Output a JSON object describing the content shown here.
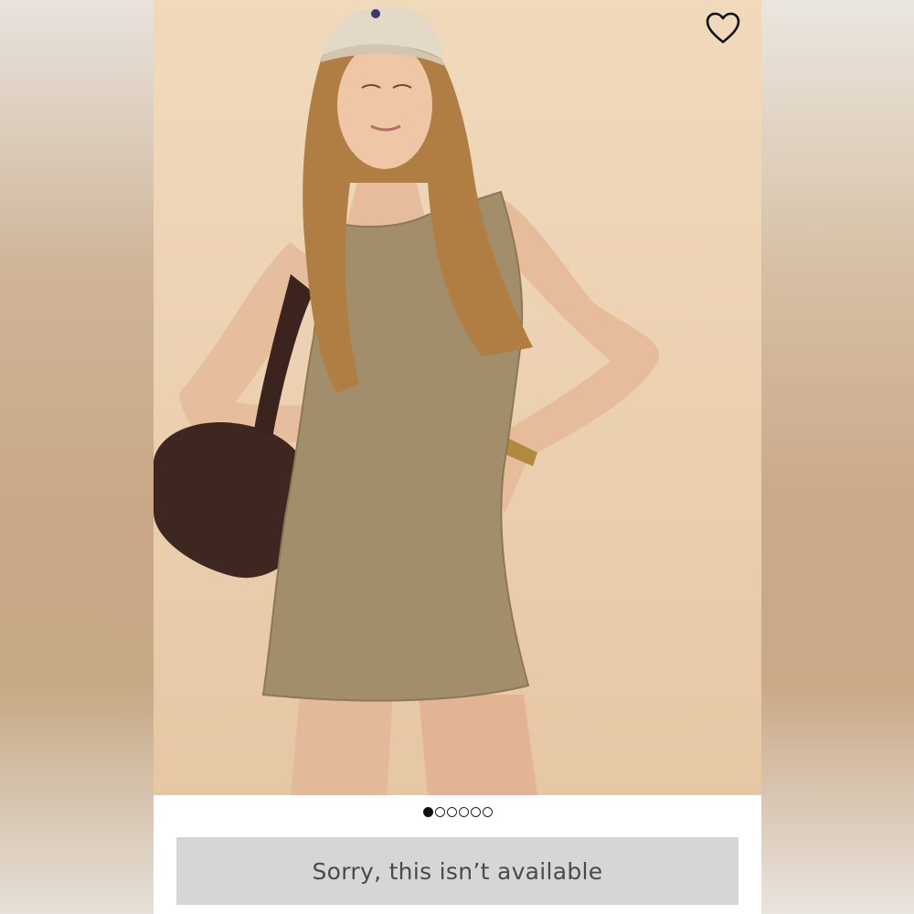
{
  "product": {
    "image_alt": "Model wearing a tan textured sleeveless mini dress with cap and brown suede bag",
    "favorite_icon": "heart-outline-icon",
    "carousel": {
      "total": 6,
      "active_index": 0
    },
    "status_button_label": "Sorry, this isn’t available"
  },
  "colors": {
    "photo_background": "#ecd2b2",
    "dress": "#a38e6c",
    "button_background": "#d6d6d6",
    "button_text": "#4a4a4a"
  }
}
